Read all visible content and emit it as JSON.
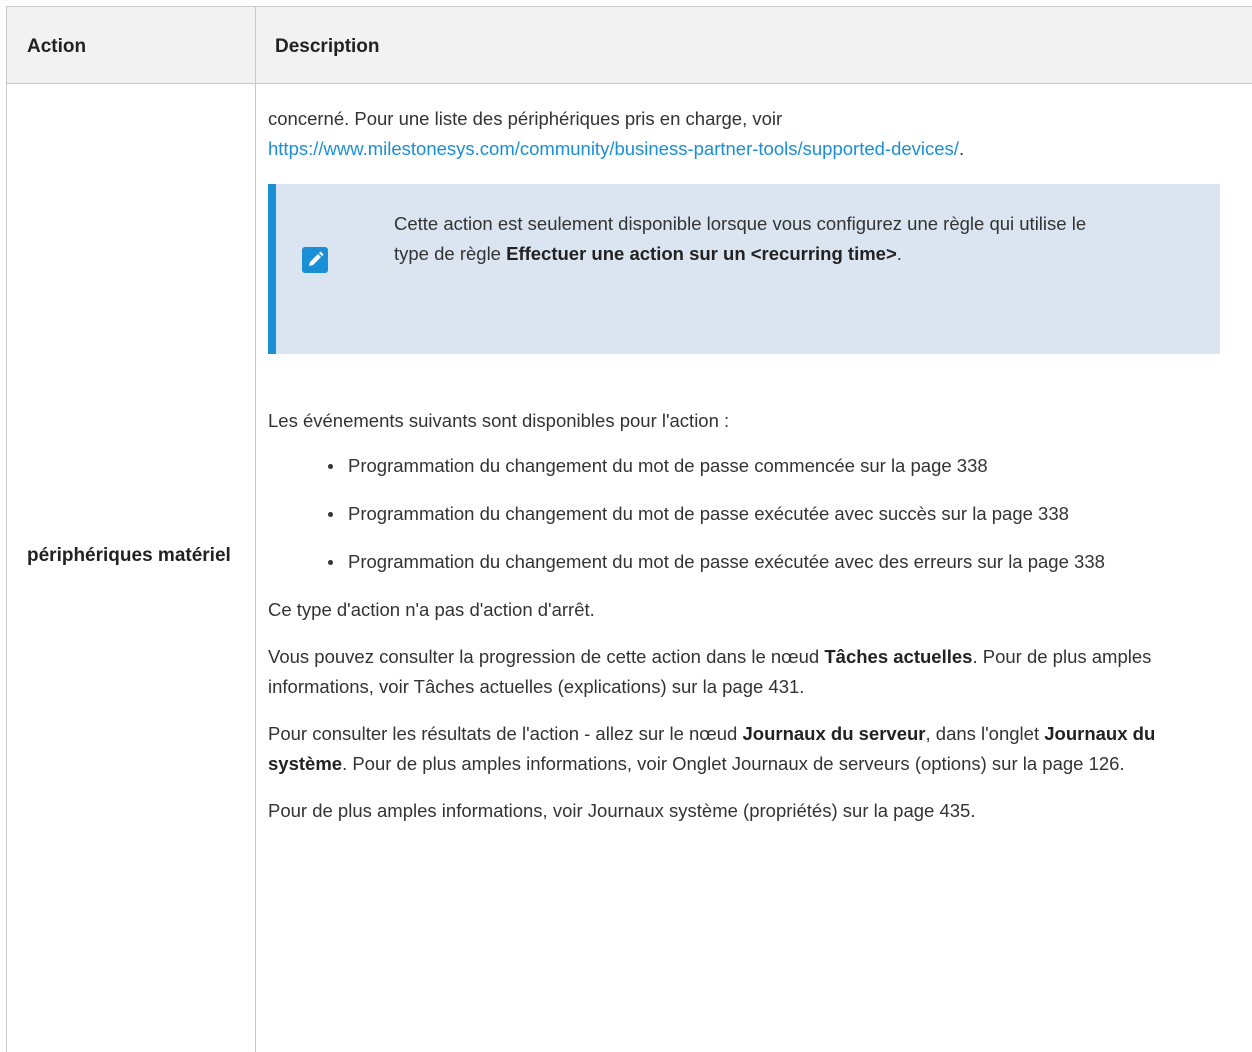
{
  "table": {
    "headers": {
      "action": "Action",
      "description": "Description"
    },
    "row": {
      "label": "périphériques matériel",
      "intro_text": "concerné. Pour une liste des périphériques pris en charge, voir",
      "link": "https://www.milestonesys.com/community/business-partner-tools/supported-devices/",
      "link_suffix": ".",
      "note": {
        "icon": "pencil-icon",
        "text_part1": "Cette action est seulement disponible lorsque vous configurez une règle qui utilise le type de règle ",
        "bold": "Effectuer une action sur un <recurring time>",
        "text_part2": "."
      },
      "events_intro": "Les événements suivants sont disponibles pour l'action :",
      "events": [
        "Programmation du changement du mot de passe commencée sur la page 338",
        "Programmation du changement du mot de passe exécutée avec succès sur la page 338",
        "Programmation du changement du mot de passe exécutée avec des erreurs sur la page 338"
      ],
      "no_stop_action": "Ce type d'action n'a pas d'action d'arrêt.",
      "progress": {
        "text1": "Vous pouvez consulter la progression de cette action dans le nœud ",
        "bold": "Tâches actuelles",
        "text2": ". Pour de plus amples informations, voir Tâches actuelles (explications) sur la page 431."
      },
      "results": {
        "text1": "Pour consulter les résultats de l'action - allez sur le nœud ",
        "bold1": "Journaux du serveur",
        "text2": ", dans l'onglet ",
        "bold2": "Journaux du système",
        "text3": ". Pour de plus amples informations, voir Onglet Journaux de serveurs (options) sur la page 126."
      },
      "more_info": "Pour de plus amples informations, voir Journaux système (propriétés) sur la page 435."
    }
  },
  "colors": {
    "link": "#1a8fd6",
    "note_bg": "#dbe4f1",
    "note_border": "#1a8fd6",
    "header_bg": "#f2f2f2"
  }
}
